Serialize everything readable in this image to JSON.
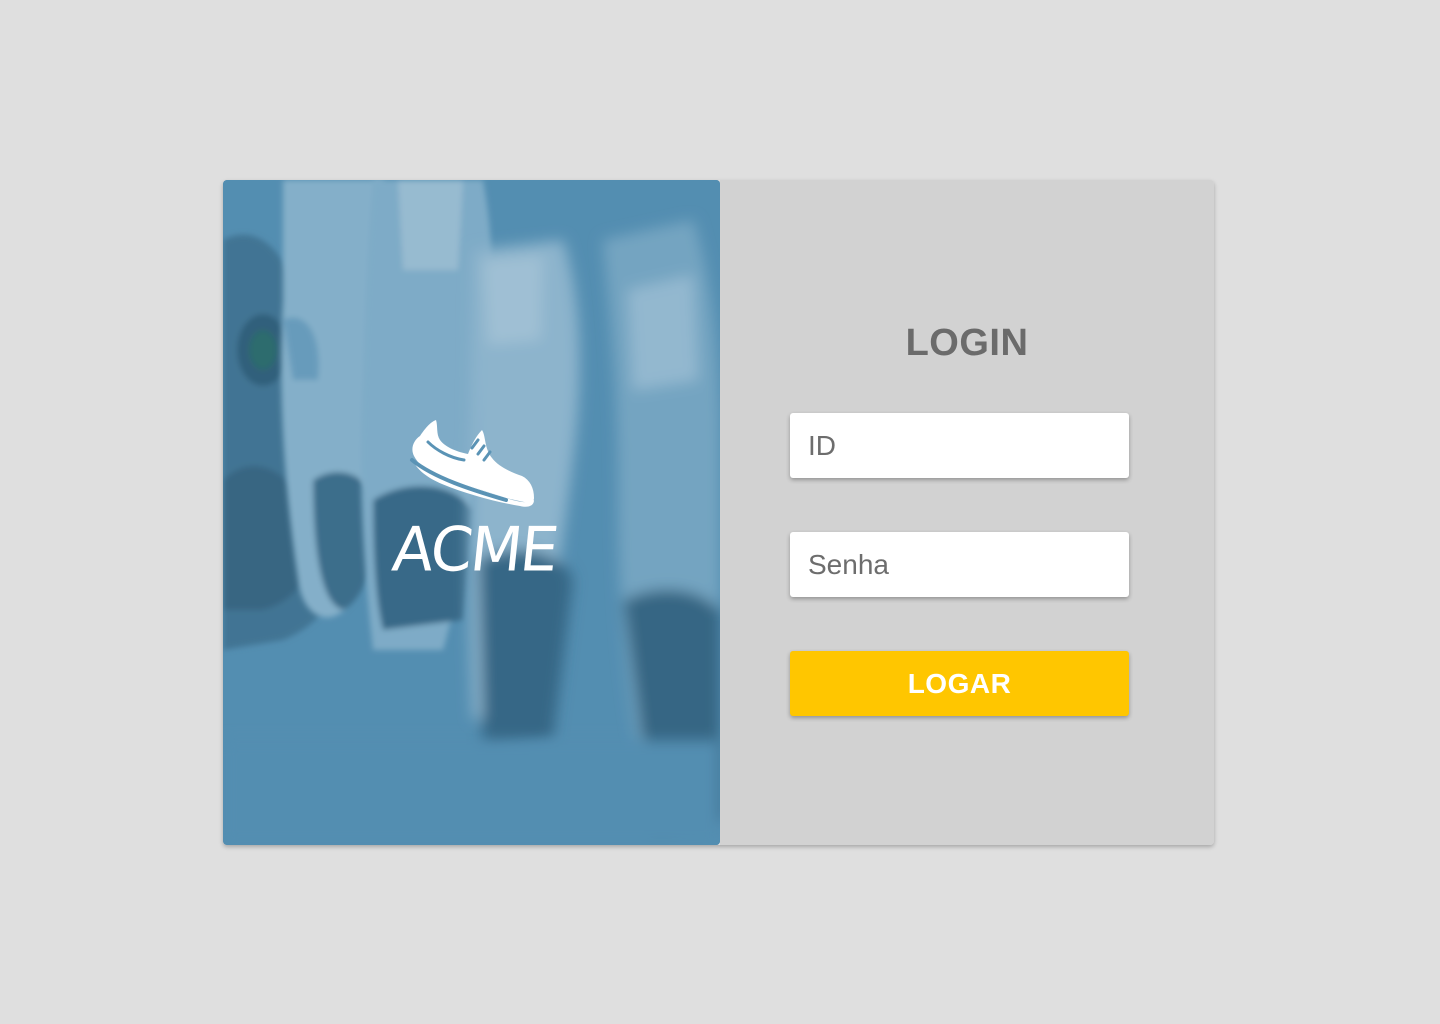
{
  "brand": {
    "name": "ACME",
    "logo_icon": "sneaker-icon"
  },
  "login": {
    "title": "LOGIN",
    "id_placeholder": "ID",
    "password_placeholder": "Senha",
    "submit_label": "LOGAR"
  },
  "colors": {
    "page_background": "#dfdfdf",
    "hero_tint": "#5a93b5",
    "panel_background": "#d2d2d2",
    "title_text": "#6b6b6b",
    "button_background": "#ffc600",
    "button_text": "#ffffff"
  }
}
